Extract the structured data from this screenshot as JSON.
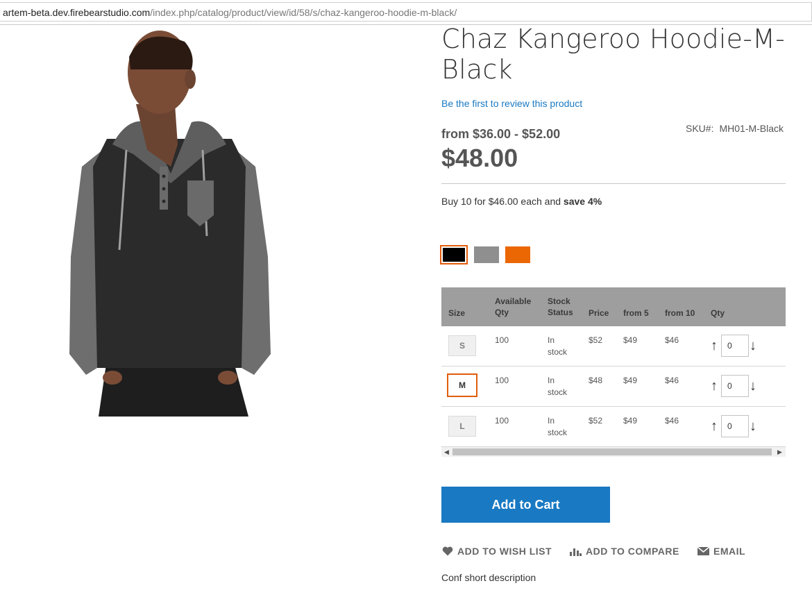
{
  "browser": {
    "url_host": "artem-beta.dev.firebearstudio.com",
    "url_path": "/index.php/catalog/product/view/id/58/s/chaz-kangeroo-hoodie-m-black/"
  },
  "product": {
    "title": "Chaz Kangeroo Hoodie-M-Black",
    "review_link": "Be the first to review this product",
    "price_range": "from $36.00 - $52.00",
    "price": "$48.00",
    "sku_label": "SKU#:",
    "sku_value": "MH01-M-Black",
    "tier_text": "Buy 10 for $46.00 each and ",
    "tier_save": "save 4%",
    "image_icon": "hoodie-model-photo"
  },
  "swatches": [
    {
      "name": "black",
      "color": "#000000",
      "selected": true
    },
    {
      "name": "gray",
      "color": "#8f8f8f",
      "selected": false
    },
    {
      "name": "orange",
      "color": "#eb6703",
      "selected": false
    }
  ],
  "matrix": {
    "headers": {
      "size": "Size",
      "available_qty": "Available Qty",
      "stock_status": "Stock Status",
      "price": "Price",
      "from5": "from 5",
      "from10": "from 10",
      "qty": "Qty"
    },
    "rows": [
      {
        "size": "S",
        "available": "100",
        "stock": "In stock",
        "price": "$52",
        "from5": "$49",
        "from10": "$46",
        "qty": "0",
        "active": false
      },
      {
        "size": "M",
        "available": "100",
        "stock": "In stock",
        "price": "$48",
        "from5": "$49",
        "from10": "$46",
        "qty": "0",
        "active": true
      },
      {
        "size": "L",
        "available": "100",
        "stock": "In stock",
        "price": "$52",
        "from5": "$49",
        "from10": "$46",
        "qty": "0",
        "active": false
      }
    ],
    "arrow_up": "↑",
    "arrow_down": "↓"
  },
  "actions": {
    "add_to_cart": "Add to Cart",
    "wishlist": "ADD TO WISH LIST",
    "compare": "ADD TO COMPARE",
    "email": "EMAIL"
  },
  "short_description": "Conf short description",
  "colors": {
    "accent": "#1979c3",
    "selected_border": "#e05d0c"
  }
}
